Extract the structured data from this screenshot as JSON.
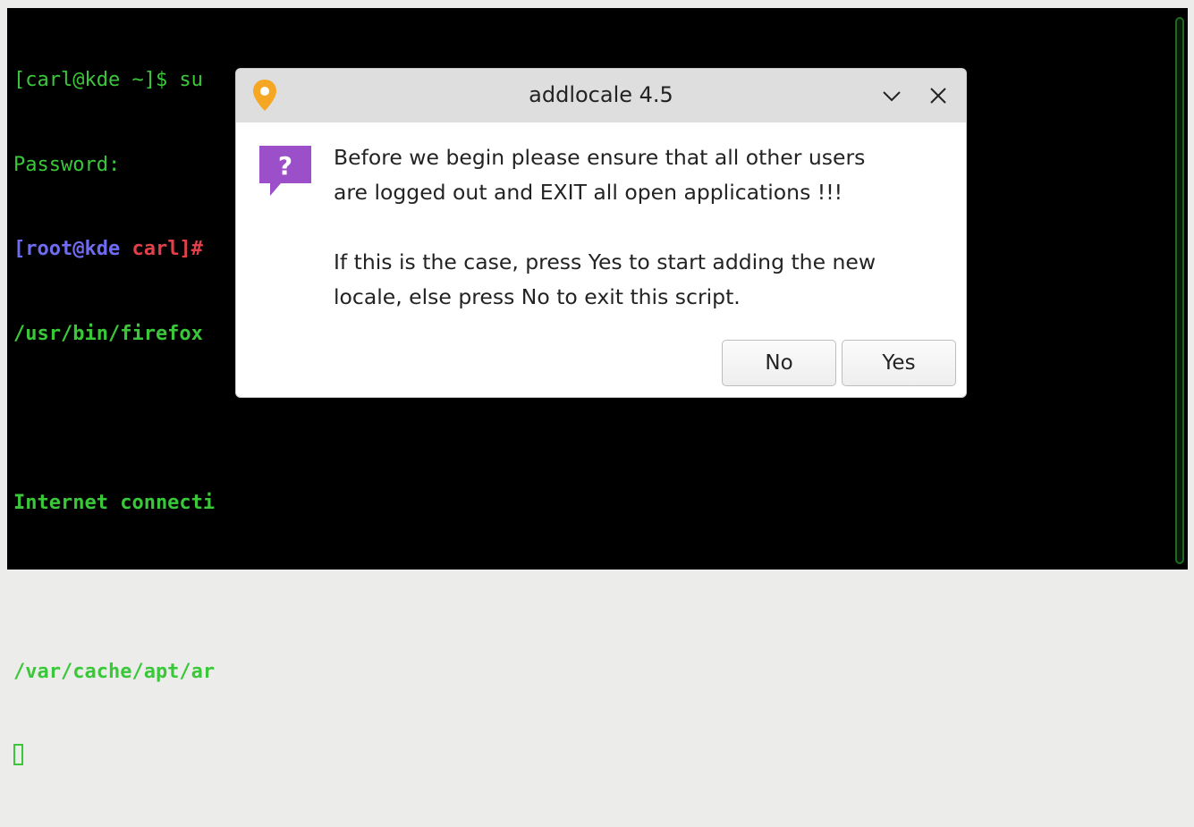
{
  "terminal": {
    "line1": "[carl@kde ~]$ su",
    "line2": "Password:",
    "line3_user": "[root@kde ",
    "line3_dir": "carl]#",
    "line4": "/usr/bin/firefox",
    "line5": "",
    "line6": "Internet connecti",
    "line7": "",
    "line8": "/var/cache/apt/ar"
  },
  "dialog": {
    "title": "addlocale 4.5",
    "message_line1": "Before we begin please ensure that all other users",
    "message_line2": "are logged out and EXIT all open applications !!!",
    "message_line3": "If this is the case, press Yes to start adding the new",
    "message_line4": "locale, else press No to exit this script.",
    "buttons": {
      "no": "No",
      "yes": "Yes"
    }
  },
  "icons": {
    "app": "location-pin-icon",
    "question": "question-speech-bubble-icon",
    "minimize": "chevron-down-icon",
    "close": "close-icon"
  },
  "colors": {
    "terminal_text": "#3ac83a",
    "prompt_user": "#6f6cf0",
    "prompt_dir": "#e0404a",
    "question_icon": "#9b4fc8",
    "app_icon": "#f5a623"
  }
}
